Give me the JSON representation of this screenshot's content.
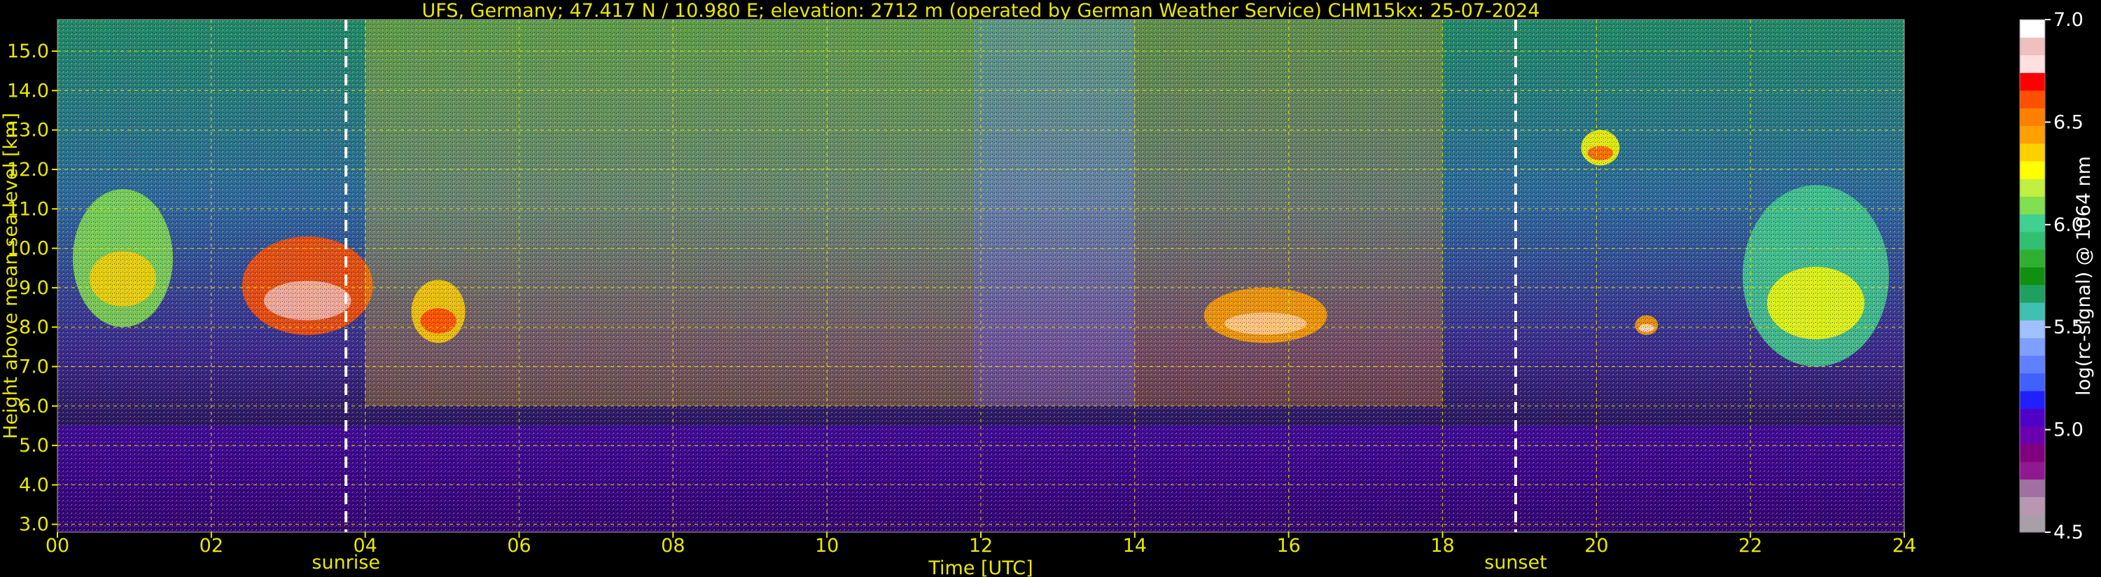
{
  "chart_data": {
    "type": "heatmap",
    "title": "UFS, Germany; 47.417 N / 10.980 E; elevation: 2712 m  (operated by German Weather Service)    CHM15kx: 25-07-2024",
    "xlabel": "Time [UTC]",
    "ylabel": "Height above mean sea level [km]",
    "xlim": [
      0,
      24
    ],
    "ylim": [
      2.8,
      15.8
    ],
    "x_ticks": [
      "00",
      "02",
      "04",
      "06",
      "08",
      "10",
      "12",
      "14",
      "16",
      "18",
      "20",
      "22",
      "24"
    ],
    "x_tick_values": [
      0,
      2,
      4,
      6,
      8,
      10,
      12,
      14,
      16,
      18,
      20,
      22,
      24
    ],
    "y_ticks": [
      "3.0",
      "4.0",
      "5.0",
      "6.0",
      "7.0",
      "8.0",
      "9.0",
      "10.0",
      "11.0",
      "12.0",
      "13.0",
      "14.0",
      "15.0"
    ],
    "y_tick_values": [
      3,
      4,
      5,
      6,
      7,
      8,
      9,
      10,
      11,
      12,
      13,
      14,
      15
    ],
    "grid": true,
    "markers": [
      {
        "label": "sunrise",
        "x": 3.75
      },
      {
        "label": "sunset",
        "x": 18.95
      }
    ],
    "colorbar": {
      "label": "log(rc-signal) @ 1064 nm",
      "range": [
        4.5,
        7.0
      ],
      "ticks": [
        "4.5",
        "5.0",
        "5.5",
        "6.0",
        "6.5",
        "7.0"
      ],
      "tick_values": [
        4.5,
        5.0,
        5.5,
        6.0,
        6.5,
        7.0
      ],
      "colors": [
        "#a8a0a8",
        "#b898b0",
        "#a070a0",
        "#901890",
        "#800080",
        "#6a00b0",
        "#5000c8",
        "#2020ff",
        "#4060ff",
        "#6080ff",
        "#80a0ff",
        "#a0c0ff",
        "#40c0b0",
        "#20a060",
        "#109010",
        "#30b030",
        "#30c070",
        "#40d090",
        "#80e050",
        "#c0f040",
        "#ffff00",
        "#ffd000",
        "#ffa000",
        "#ff8000",
        "#ff5000",
        "#ff0000",
        "#ffe0e0",
        "#f0c0c0",
        "#ffffff"
      ]
    },
    "features": [
      {
        "kind": "cirrus",
        "x": [
          0.2,
          1.5
        ],
        "y": [
          8.0,
          11.5
        ],
        "level": 6.1
      },
      {
        "kind": "cirrus",
        "x": [
          2.4,
          4.1
        ],
        "y": [
          7.8,
          10.3
        ],
        "level": 6.6
      },
      {
        "kind": "cirrus",
        "x": [
          4.6,
          5.3
        ],
        "y": [
          7.6,
          9.2
        ],
        "level": 6.4
      },
      {
        "kind": "cirrus",
        "x": [
          14.9,
          16.5
        ],
        "y": [
          7.6,
          9.0
        ],
        "level": 6.5
      },
      {
        "kind": "cirrus",
        "x": [
          19.8,
          20.3
        ],
        "y": [
          12.1,
          13.0
        ],
        "level": 6.3
      },
      {
        "kind": "cirrus",
        "x": [
          21.9,
          23.8
        ],
        "y": [
          7.0,
          11.6
        ],
        "level": 6.0
      },
      {
        "kind": "cirrus",
        "x": [
          20.5,
          20.8
        ],
        "y": [
          7.8,
          8.3
        ],
        "level": 6.5
      },
      {
        "kind": "noisy",
        "x": [
          4.0,
          11.9
        ],
        "y": [
          6.0,
          15.8
        ],
        "level": 6.4
      },
      {
        "kind": "noisy",
        "x": [
          11.9,
          14.0
        ],
        "y": [
          6.0,
          15.8
        ],
        "level": 6.9
      },
      {
        "kind": "noisy",
        "x": [
          14.0,
          18.0
        ],
        "y": [
          6.0,
          15.8
        ],
        "level": 6.5
      },
      {
        "kind": "boundary-layer",
        "x": [
          0,
          24
        ],
        "y": [
          2.8,
          5.5
        ],
        "level": 5.0
      }
    ]
  }
}
